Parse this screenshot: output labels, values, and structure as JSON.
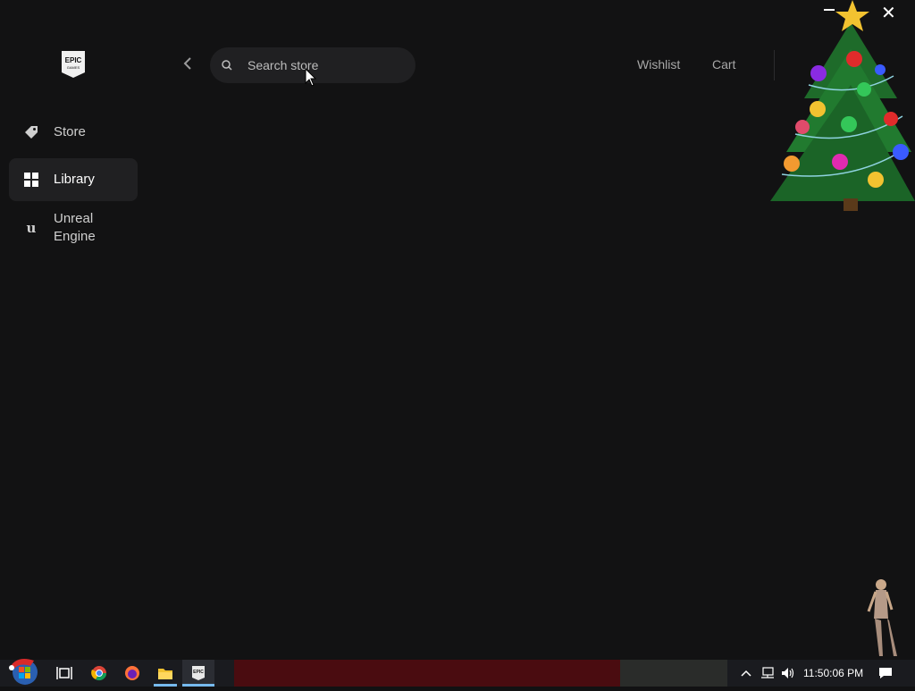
{
  "sidebar": {
    "logo_text": "EPIC GAMES",
    "items": [
      {
        "label": "Store",
        "icon": "tag-icon"
      },
      {
        "label": "Library",
        "icon": "grid-icon",
        "active": true
      },
      {
        "label": "Unreal Engine",
        "icon": "unreal-icon"
      }
    ]
  },
  "header": {
    "search": {
      "placeholder": "Search store",
      "value": ""
    },
    "links": {
      "wishlist": "Wishlist",
      "cart": "Cart"
    }
  },
  "taskbar": {
    "clock": "11:50:06 PM",
    "apps": [
      "start-button",
      "task-view-icon",
      "chrome-icon",
      "firefox-icon",
      "file-explorer-icon",
      "epic-games-icon"
    ]
  },
  "colors": {
    "background": "#121213",
    "active_nav": "#202022",
    "search_bg": "#202022",
    "taskbar": "#1a1b1f",
    "accent": "#76b9ed"
  }
}
